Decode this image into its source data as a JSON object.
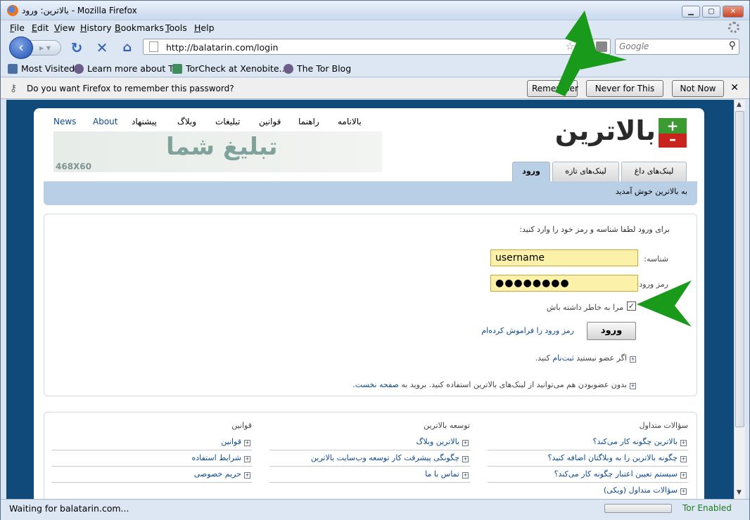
{
  "window": {
    "title": "بالاترین: ورود - Mozilla Firefox"
  },
  "menu": [
    "File",
    "Edit",
    "View",
    "History",
    "Bookmarks",
    "Tools",
    "Help"
  ],
  "nav": {
    "url": "http://balatarin.com/login",
    "search_placeholder": "Google"
  },
  "bookmarks": [
    "Most Visited",
    "Learn more about Tor",
    "TorCheck at Xenobite....",
    "The Tor Blog"
  ],
  "notification": {
    "message": "Do you want Firefox to remember this password?",
    "remember": "Remember",
    "never": "Never for This Site",
    "not_now": "Not Now"
  },
  "site": {
    "logo": "بالاترین",
    "topnav": [
      "News",
      "About",
      "پیشنهاد",
      "وبلاگ",
      "تبلیغات",
      "قوانین",
      "راهنما",
      "بالانامه"
    ],
    "ad_text": "تبلیغ شما",
    "ad_size": "468X60",
    "tabs": [
      "لینک‌های داغ",
      "لینک‌های تازه",
      "ورود"
    ],
    "welcome": "به بالاترین خوش آمدید",
    "login": {
      "intro": "برای ورود لطفا شناسه و رمز خود را وارد کنید:",
      "user_label": "شناسه:",
      "user_value": "username",
      "pass_label": "رمز ورود:",
      "pass_value": "●●●●●●●●",
      "remember_label": "مرا به خاطر داشته باش",
      "submit": "ورود",
      "forgot": "رمز ورود را فراموش کرده‌ام",
      "register_pre": "اگر عضو نیستید ",
      "register_link": "ثبت‌نام",
      "register_post": " کنید.",
      "guest_pre": "بدون عضو‌بودن هم می‌توانید از لینک‌های بالاترین استفاده کنید. بروید به ",
      "guest_link": "صفحه نخست",
      "guest_post": "."
    },
    "footer": {
      "faq": {
        "title": "سؤالات متداول",
        "items": [
          "بالاترین چگونه کار می‌کند؟",
          "چگونه بالاترین را به وبلاگتان اضافه کنید؟",
          "سیستم تعیین اعتبار چگونه کار می‌کند؟",
          "سؤالات متداول (ویکی)"
        ]
      },
      "dev": {
        "title": "توسعه بالاترین",
        "items": [
          "بالاترین وبلاگ",
          "چگونگی پیشرفت کار توسعه وب‌سایت بالاترین",
          "تماس با ما"
        ]
      },
      "rules": {
        "title": "قوانین",
        "items": [
          "قوانین",
          "شرایط استفاده",
          "حریم خصوصی"
        ]
      }
    }
  },
  "status": {
    "text": "Waiting for balatarin.com...",
    "tor": "Tor Enabled"
  },
  "colors": {
    "page_bg": "#0f4a7a",
    "highlight": "#b9cfe6",
    "field": "#fbf1a9",
    "arrow": "#1a9a1a"
  }
}
